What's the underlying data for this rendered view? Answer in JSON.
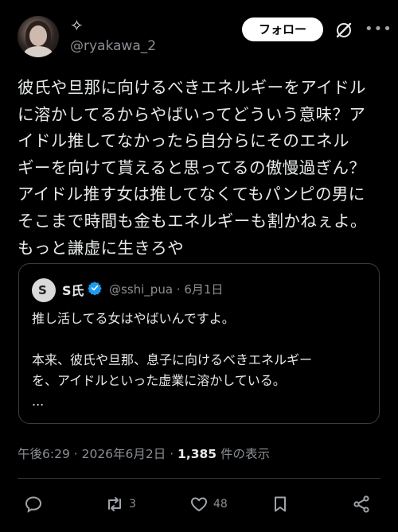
{
  "header": {
    "sparkle": "✧",
    "handle": "@ryakawa_2",
    "follow_label": "フォロー"
  },
  "post": {
    "text": "彼氏や旦那に向けるべきエネルギーをアイドル\nに溶かしてるからやばいってどういう意味？ア\nイドル推してなかったら自分らにそのエネル\nギーを向けて貰えると思ってるの傲慢過ぎん？\nアイドル推す女は推してなくてもパンピの男に\nそこまで時間も金もエネルギーも割かねぇよ。\nもっと謙虚に生きろや"
  },
  "quote": {
    "avatar_letter": "S",
    "name": "S氏",
    "handle_date": "@sshi_pua · 6月1日",
    "text": "推し活してる女はやばいんですよ。\n\n本来、彼氏や旦那、息子に向けるべきエネルギー\nを、アイドルといった虚業に溶かしている。\n..."
  },
  "meta": {
    "time": "午後6:29",
    "sep1": " · ",
    "date": "2026年6月2日",
    "sep2": " · ",
    "views": "1,385",
    "views_label": " 件の表示"
  },
  "actions": {
    "retweets": "3",
    "likes": "48"
  },
  "colors": {
    "background": "#000000",
    "text": "#e7e9ea",
    "muted": "#8b8f94",
    "verified": "#1d9bf0"
  }
}
